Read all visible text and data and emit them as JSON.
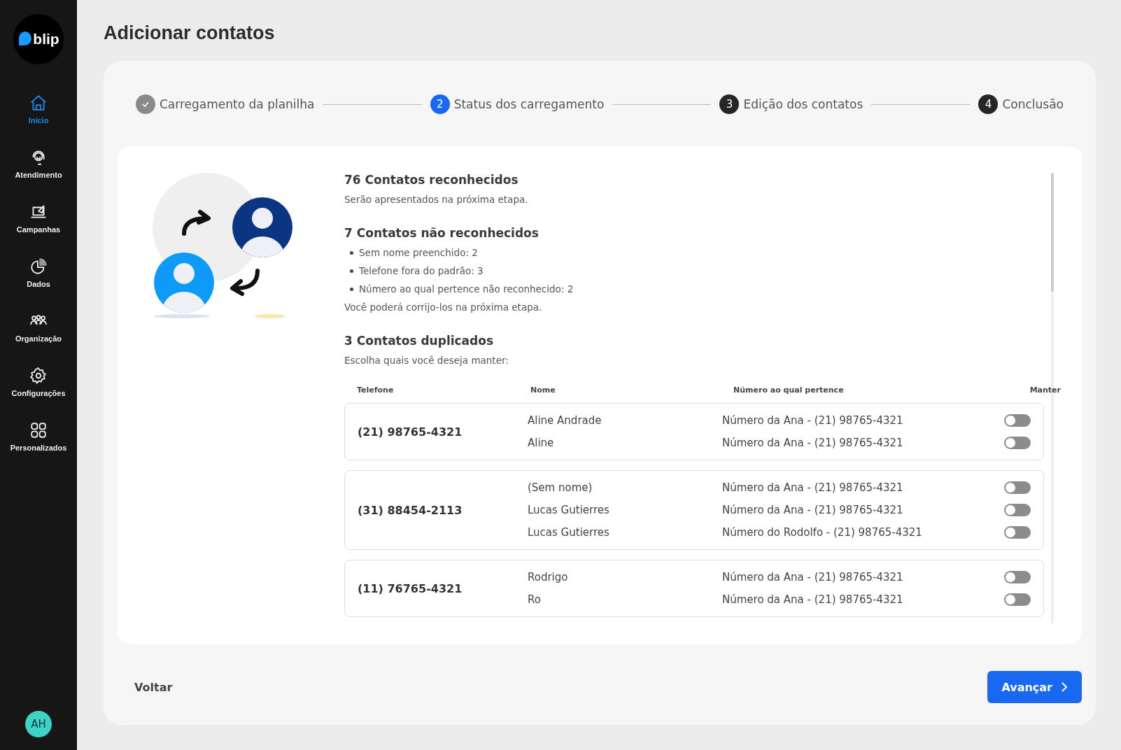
{
  "sidebar": {
    "logo": "blip",
    "items": [
      {
        "label": "Início",
        "selected": true
      },
      {
        "label": "Atendimento",
        "selected": false
      },
      {
        "label": "Campanhas",
        "selected": false
      },
      {
        "label": "Dados",
        "selected": false
      },
      {
        "label": "Organização",
        "selected": false
      },
      {
        "label": "Configurações",
        "selected": false
      },
      {
        "label": "Personalizados",
        "selected": false
      }
    ],
    "avatar": "AH"
  },
  "page_title": "Adicionar contatos",
  "steps": [
    {
      "kind": "done",
      "label": "Carregamento da planilha"
    },
    {
      "kind": "current",
      "number": "2",
      "label": "Status dos carregamento"
    },
    {
      "kind": "upcoming",
      "number": "3",
      "label": "Edição dos contatos"
    },
    {
      "kind": "upcoming",
      "number": "4",
      "label": "Conclusão"
    }
  ],
  "summary": [
    {
      "title": "76 Contatos reconhecidos",
      "note": "Serão apresentados na próxima etapa."
    },
    {
      "title": "7 Contatos não reconhecidos",
      "bullets": [
        "Sem nome preenchido: 2",
        "Telefone fora do padrão: 3",
        "Número ao qual pertence não reconhecido: 2"
      ],
      "note": "Você poderá corrijo-los na próxima etapa."
    },
    {
      "title": "3 Contatos duplicados",
      "note": "Escolha quais você deseja manter:"
    }
  ],
  "table": {
    "columns": [
      "Telefone",
      "Nome",
      "Número ao qual pertence",
      "Manter"
    ],
    "groups": [
      {
        "phone": "(21) 98765-4321",
        "rows": [
          {
            "name": "Aline Andrade",
            "owner": "Número da Ana - (21) 98765-4321",
            "on": false
          },
          {
            "name": "Aline",
            "owner": "Número da Ana - (21) 98765-4321",
            "on": false
          }
        ]
      },
      {
        "phone": "(31) 88454-2113",
        "rows": [
          {
            "name": "(Sem nome)",
            "owner": "Número da Ana - (21) 98765-4321",
            "on": false
          },
          {
            "name": "Lucas Gutierres",
            "owner": "Número da Ana - (21) 98765-4321",
            "on": false
          },
          {
            "name": "Lucas Gutierres",
            "owner": "Número do Rodolfo - (21) 98765-4321",
            "on": false
          }
        ]
      },
      {
        "phone": "(11) 76765-4321",
        "rows": [
          {
            "name": "Rodrigo",
            "owner": "Número da Ana - (21) 98765-4321",
            "on": false
          },
          {
            "name": "Ro",
            "owner": "Número da Ana - (21) 98765-4321",
            "on": false
          }
        ]
      }
    ]
  },
  "footer": {
    "back": "Voltar",
    "next": "Avançar"
  }
}
